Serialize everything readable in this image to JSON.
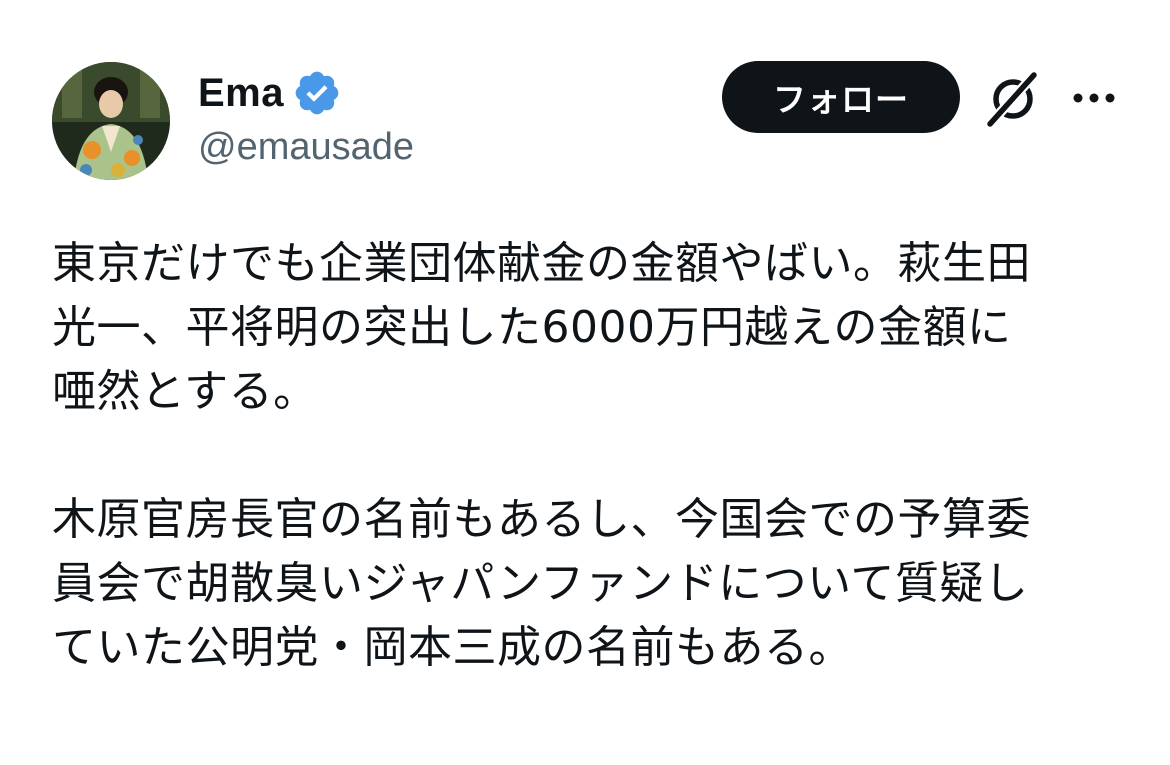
{
  "tweet": {
    "author": {
      "display_name": "Ema",
      "handle": "@emausade",
      "verified": true,
      "verified_color": "#4a99e9"
    },
    "actions": {
      "follow_label": "フォロー",
      "grok_icon": "grok-slash-icon",
      "more_icon": "more-dots-icon"
    },
    "paragraphs": [
      {
        "lines": [
          "東京だけでも企業団体献金の金額やばい。萩生田",
          "光一、平将明の突出した6000万円越えの金額に",
          "唖然とする。"
        ]
      },
      {
        "lines": [
          "木原官房長官の名前もあるし、今国会での予算委",
          "員会で胡散臭いジャパンファンドについて質疑し",
          "ていた公明党・岡本三成の名前もある。"
        ]
      }
    ]
  },
  "colors": {
    "text_primary": "#0f1419",
    "text_secondary": "#536471",
    "button_bg": "#0f1419",
    "button_text": "#ffffff"
  }
}
